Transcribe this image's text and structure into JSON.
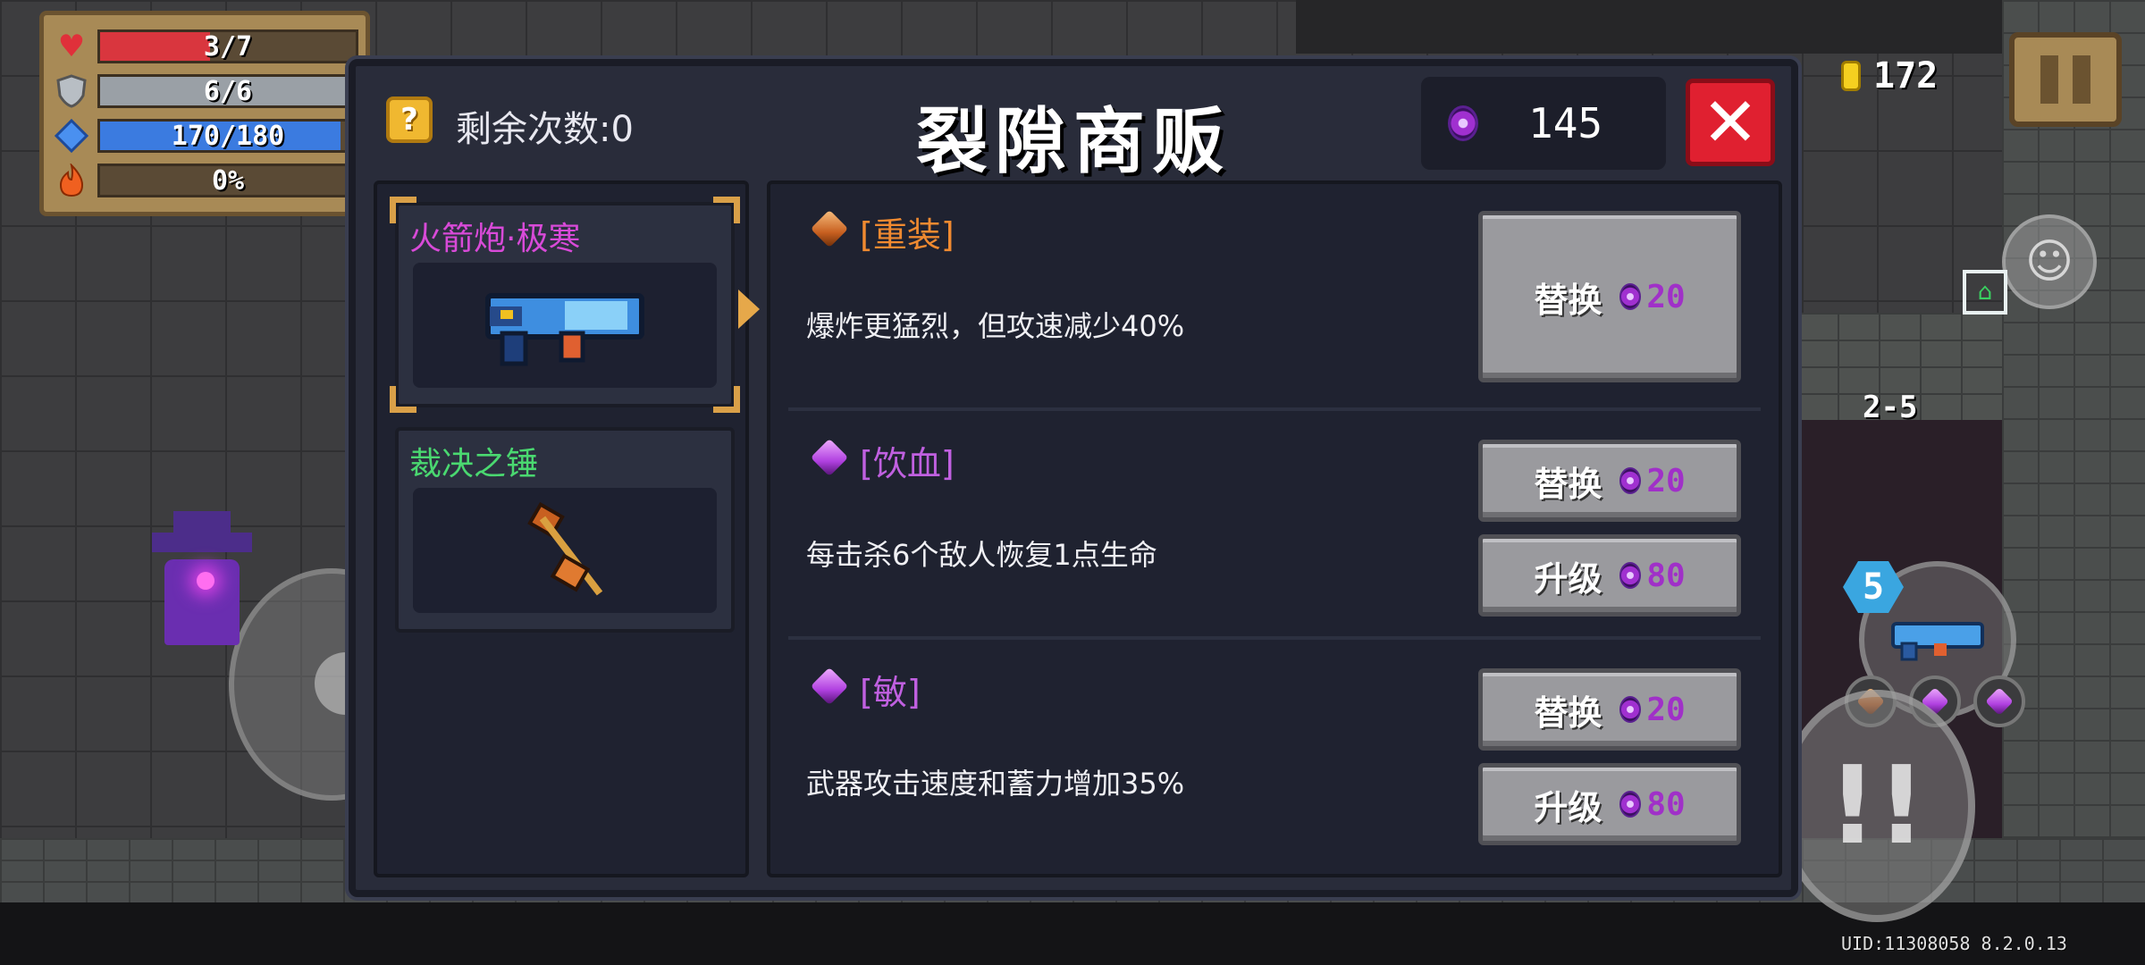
{
  "hud": {
    "health": "3/7",
    "health_fraction": 0.43,
    "armor": "6/6",
    "armor_fraction": 1.0,
    "energy": "170/180",
    "energy_fraction": 0.94,
    "skill_charge": "0%",
    "skill_charge_fraction": 0.0,
    "coins": "172",
    "level": "2-5",
    "weapon_ammo_count": "5",
    "uid": "UID:11308058 8.2.0.13"
  },
  "shop": {
    "remaining_label": "剩余次数:0",
    "remaining_icon": "?",
    "title": "裂隙商贩",
    "currency": "145",
    "close_icon": "✕",
    "weapons": [
      {
        "name": "火箭炮·极寒",
        "color": "#d84ad8",
        "selected": true
      },
      {
        "name": "裁决之锤",
        "color": "#4ad870",
        "selected": false
      }
    ],
    "affixes": [
      {
        "name": "[重装]",
        "color": "#f08a30",
        "gem": "orange",
        "description": "爆炸更猛烈，但攻速减少40%",
        "buttons": [
          {
            "label": "替换",
            "cost": "20"
          }
        ]
      },
      {
        "name": "[饮血]",
        "color": "#c060e0",
        "gem": "purple",
        "description": "每击杀6个敌人恢复1点生命",
        "buttons": [
          {
            "label": "替换",
            "cost": "20"
          },
          {
            "label": "升级",
            "cost": "80"
          }
        ]
      },
      {
        "name": "[敏]",
        "color": "#c060e0",
        "gem": "purple",
        "description": "武器攻击速度和蓄力增加35%",
        "buttons": [
          {
            "label": "替换",
            "cost": "20"
          },
          {
            "label": "升级",
            "cost": "80"
          }
        ]
      }
    ]
  },
  "colors": {
    "health": "#d9363e",
    "armor": "#9aa0a6",
    "energy": "#3b7be0",
    "skill_charge": "#e06020"
  },
  "icons": {
    "health": "heart-icon",
    "armor": "shield-icon",
    "energy": "energy-crystal-icon",
    "skill_charge": "fire-icon"
  }
}
